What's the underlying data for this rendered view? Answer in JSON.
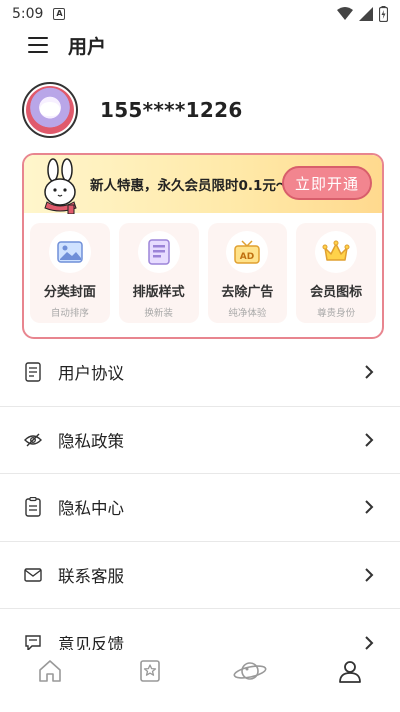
{
  "status_bar": {
    "time": "5:09",
    "notification_letter": "A"
  },
  "header": {
    "title": "用户"
  },
  "profile": {
    "phone": "155****1226"
  },
  "vip": {
    "promo_text": "新人特惠，永久会员限时0.1元～",
    "open_button": "立即开通",
    "features": [
      {
        "label": "分类封面",
        "sub": "自动排序",
        "icon": "image-icon"
      },
      {
        "label": "排版样式",
        "sub": "换新装",
        "icon": "layout-icon"
      },
      {
        "label": "去除广告",
        "sub": "纯净体验",
        "icon": "ad-icon"
      },
      {
        "label": "会员图标",
        "sub": "尊贵身份",
        "icon": "crown-icon"
      }
    ]
  },
  "menu": {
    "items": [
      {
        "label": "用户协议",
        "icon": "document-icon"
      },
      {
        "label": "隐私政策",
        "icon": "eye-off-icon"
      },
      {
        "label": "隐私中心",
        "icon": "checklist-icon"
      },
      {
        "label": "联系客服",
        "icon": "mail-icon"
      },
      {
        "label": "意见反馈",
        "icon": "feedback-icon"
      }
    ]
  },
  "bottom_nav": [
    "home-icon",
    "bookshelf-icon",
    "planet-icon",
    "profile-icon"
  ],
  "colors": {
    "accent": "#f2858f",
    "border_accent": "#e8858f",
    "banner_yellow": "#ffe9a8"
  }
}
